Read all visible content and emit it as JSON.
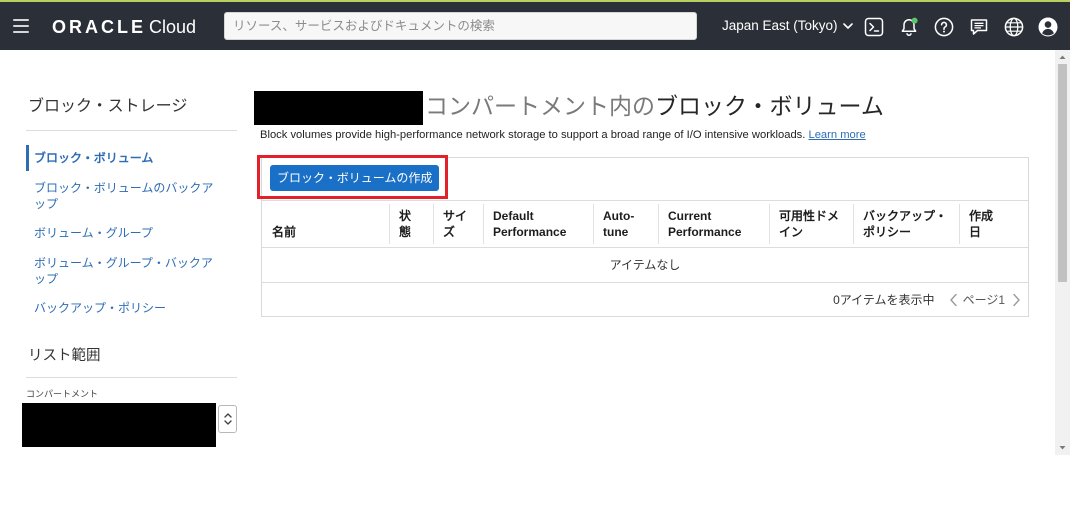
{
  "colors": {
    "header_bg": "#2b2f37",
    "top_accent": "#b7d160",
    "link": "#2e6db4",
    "primary_button": "#1a6fc6",
    "highlight": "#e3212b",
    "notification_dot": "#5cc46a",
    "redaction": "#000000"
  },
  "header": {
    "logo_brand": "ORACLE",
    "logo_product": "Cloud",
    "search_placeholder": "リソース、サービスおよびドキュメントの検索",
    "region": "Japan East (Tokyo)",
    "icons": [
      "menu-icon",
      "chevron-down-icon",
      "cloud-shell-icon",
      "notifications-icon",
      "help-icon",
      "feedback-icon",
      "language-icon",
      "profile-icon"
    ]
  },
  "sidebar": {
    "title": "ブロック・ストレージ",
    "items": [
      {
        "label": "ブロック・ボリューム",
        "active": true
      },
      {
        "label": "ブロック・ボリュームのバックアップ",
        "active": false
      },
      {
        "label": "ボリューム・グループ",
        "active": false
      },
      {
        "label": "ボリューム・グループ・バックアップ",
        "active": false
      },
      {
        "label": "バックアップ・ポリシー",
        "active": false
      }
    ],
    "scope_title": "リスト範囲",
    "compartment_label": "コンパートメント",
    "compartment_icon": "select-arrows-icon"
  },
  "main": {
    "title_muted": "コンパートメント内の",
    "title_main": "ブロック・ボリューム",
    "description": "Block volumes provide high-performance network storage to support a broad range of I/O intensive workloads.",
    "learn_more": "Learn more",
    "create_button": "ブロック・ボリュームの作成",
    "table": {
      "columns": [
        "名前",
        "状態",
        "サイズ",
        "Default Performance",
        "Auto-tune",
        "Current Performance",
        "可用性ドメイン",
        "バックアップ・ポリシー",
        "作成日"
      ],
      "rows": [],
      "empty_text": "アイテムなし",
      "item_count": "0アイテムを表示中",
      "page_label": "ページ1",
      "pagination_icons": [
        "chevron-left-icon",
        "chevron-right-icon"
      ]
    }
  }
}
